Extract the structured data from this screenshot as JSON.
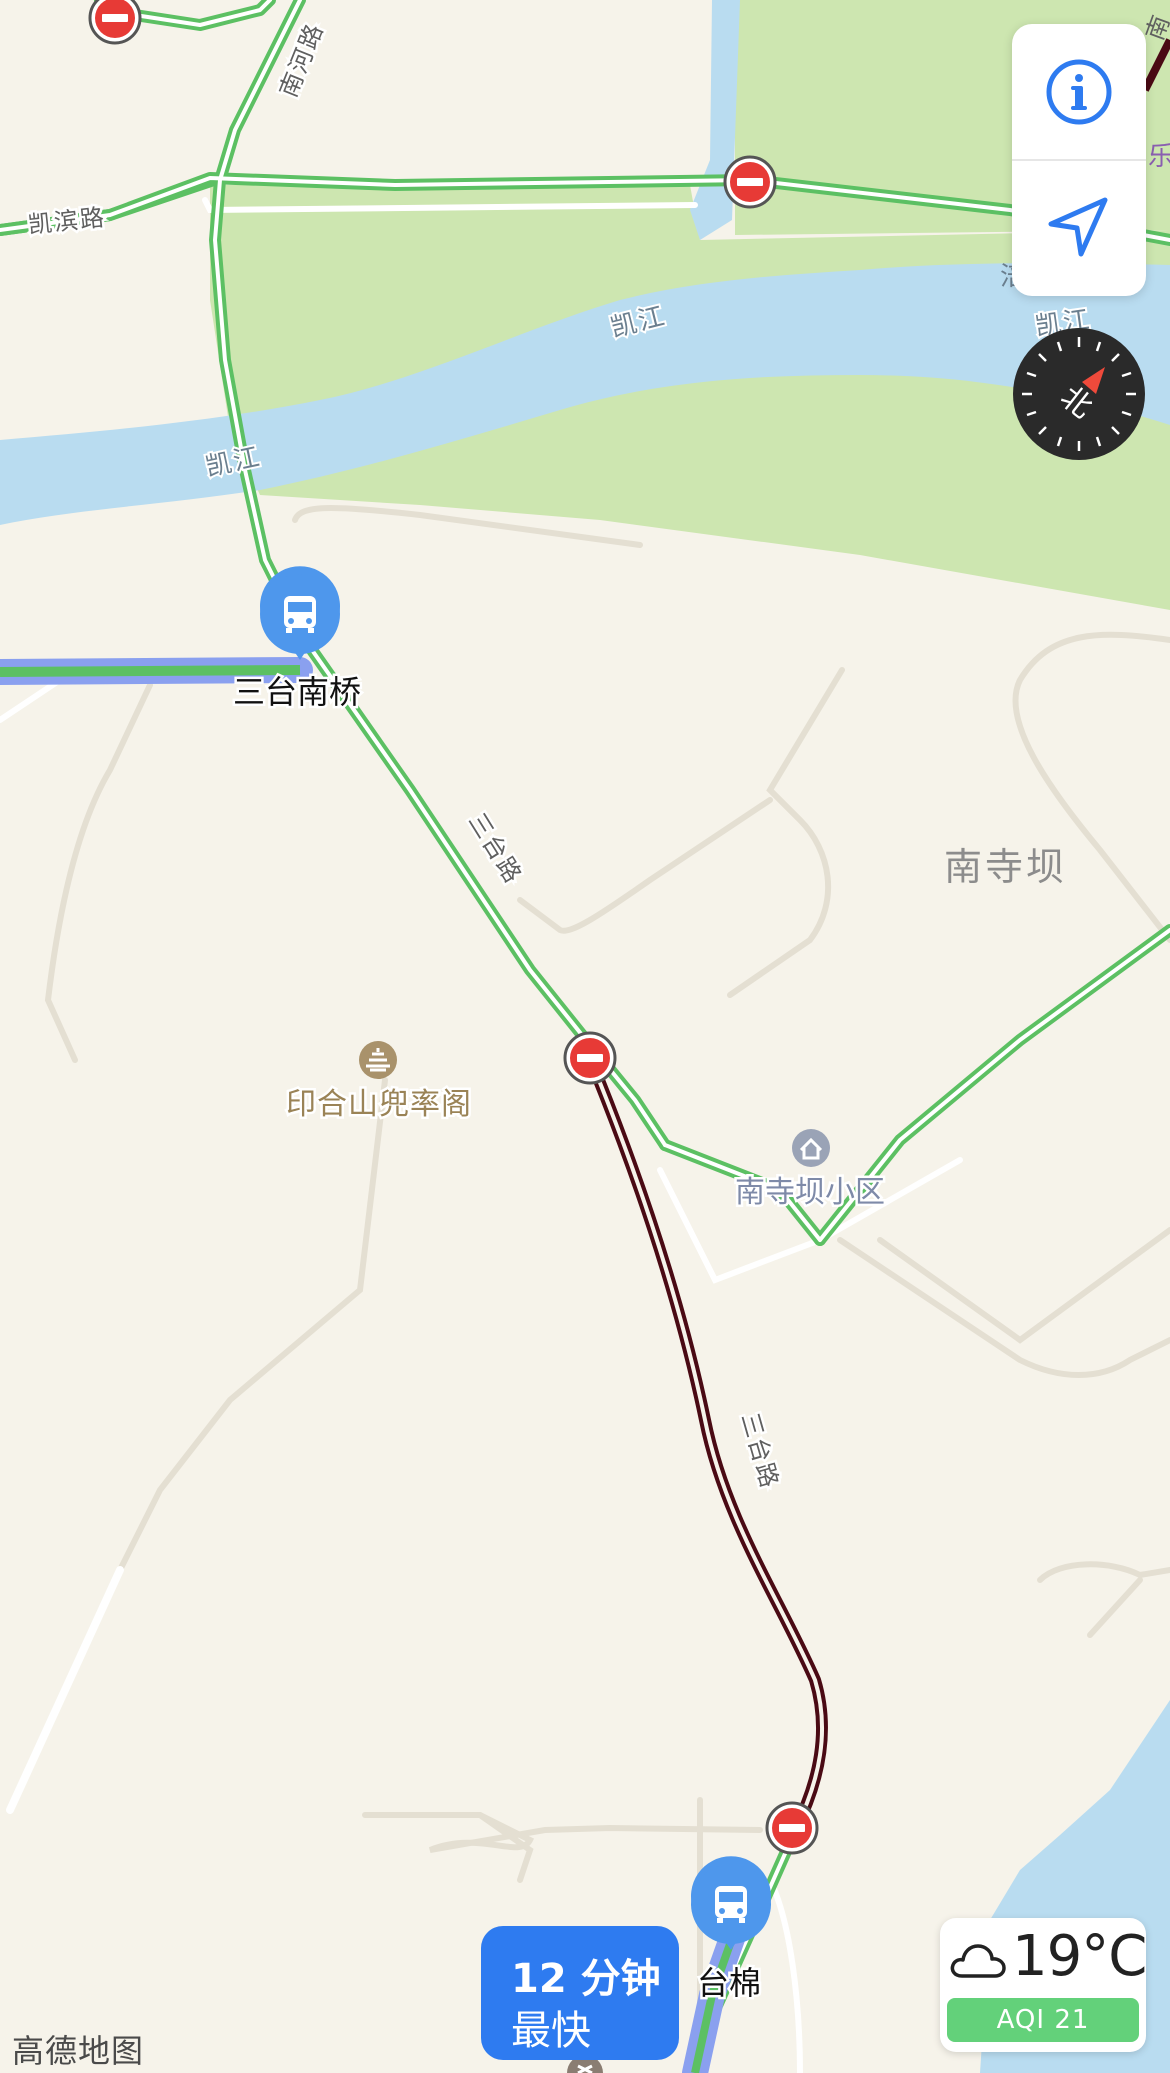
{
  "map": {
    "rivers": [
      "凯江",
      "凯江",
      "凯江"
    ],
    "roads": [
      "南河路",
      "凯滨路",
      "三台路",
      "三台路"
    ],
    "area_label": "南寺坝",
    "pois": {
      "pagoda": "印合山兜率阁",
      "residential": "南寺坝小区"
    },
    "bus_stops": [
      "三台南桥",
      "台棉"
    ],
    "edge_partial_text": {
      "top_right_road": "南",
      "right_poi": "乐",
      "right_river": "凯江",
      "right_small": "涪"
    }
  },
  "controls": {
    "info_icon": "info-icon",
    "locate_icon": "location-arrow-icon",
    "compass_label": "北"
  },
  "weather": {
    "icon": "cloud-icon",
    "temperature": "19°C",
    "aqi": "AQI 21"
  },
  "route_card": {
    "duration": "12 分钟",
    "tag": "最快"
  },
  "watermark": "高德地图",
  "colors": {
    "land": "#f6f3ea",
    "park": "#cde6b0",
    "water": "#b9dcf0",
    "road_green": "#5cc063",
    "road_congested": "#4a0a14",
    "route_blue": "#8aa0ef",
    "accent_blue": "#2e7bf0",
    "no_entry_red": "#e73a36",
    "aqi_green": "#63d17a"
  }
}
